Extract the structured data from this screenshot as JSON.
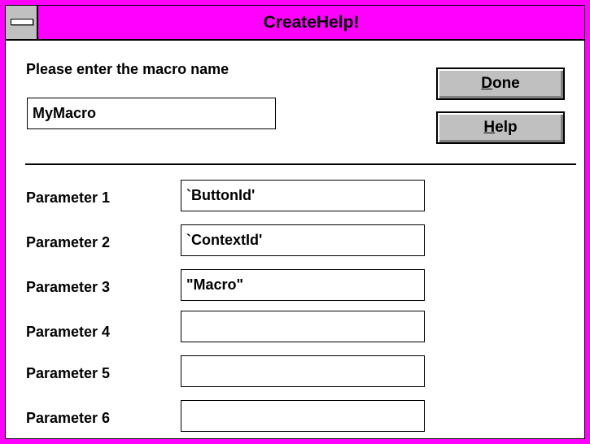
{
  "window": {
    "title": "CreateHelp!"
  },
  "macro": {
    "prompt": "Please enter the macro name",
    "value": "MyMacro"
  },
  "buttons": {
    "done": {
      "mnemonic": "D",
      "rest": "one"
    },
    "help": {
      "mnemonic": "H",
      "rest": "elp"
    }
  },
  "parameters": [
    {
      "label": "Parameter 1",
      "value": "`ButtonId'"
    },
    {
      "label": "Parameter 2",
      "value": "`ContextId'"
    },
    {
      "label": "Parameter 3",
      "value": "\"Macro\""
    },
    {
      "label": "Parameter 4",
      "value": ""
    },
    {
      "label": "Parameter 5",
      "value": ""
    },
    {
      "label": "Parameter 6",
      "value": ""
    }
  ],
  "colors": {
    "titlebar": "#ff00ff",
    "button_face": "#c0c0c0"
  }
}
